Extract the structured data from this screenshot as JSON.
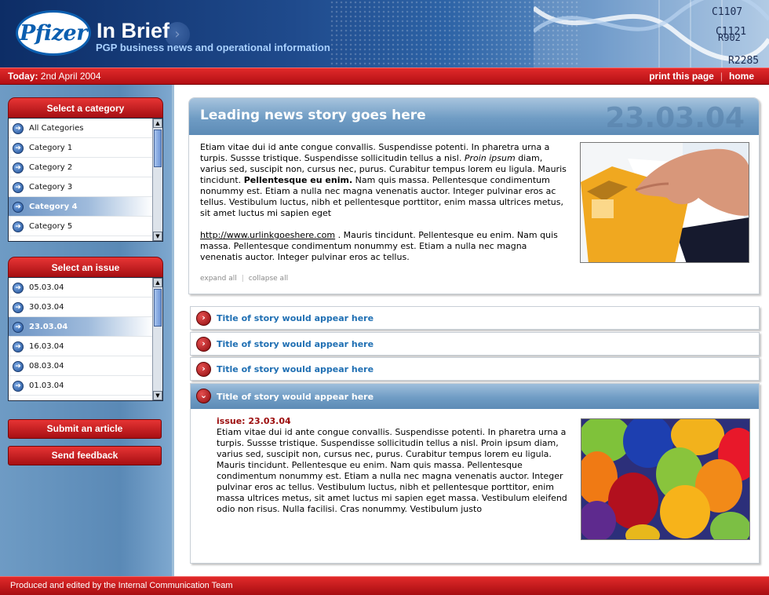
{
  "header": {
    "logo_text": "Pfizer",
    "title": "In Brief",
    "subtitle": "PGP business news and operational information",
    "graphic_codes": [
      "C1107",
      "C1121",
      "R902",
      "R2285"
    ]
  },
  "topbar": {
    "today_label": "Today:",
    "today_value": "2nd April 2004",
    "print_label": "print this page",
    "separator": "|",
    "home_label": "home"
  },
  "sidebar": {
    "category_title": "Select a category",
    "categories": [
      "All Categories",
      "Category 1",
      "Category 2",
      "Category 3",
      "Category 4",
      "Category 5"
    ],
    "active_category": "Category 4",
    "issue_title": "Select an issue",
    "issues": [
      "05.03.04",
      "30.03.04",
      "23.03.04",
      "16.03.04",
      "08.03.04",
      "01.03.04"
    ],
    "active_issue": "23.03.04",
    "submit_label": "Submit an article",
    "feedback_label": "Send feedback"
  },
  "lead": {
    "title": "Leading news story goes here",
    "date": "23.03.04",
    "para1_a": "Etiam vitae dui id ante congue convallis. Suspendisse potenti. In pharetra urna a turpis. Sussse tristique. Suspendisse sollicitudin tellus a nisl. ",
    "para1_italic": "Proin ipsum",
    "para1_b": " diam, varius sed, suscipit non, cursus nec, purus. Curabitur tempus lorem eu ligula. Mauris tincidunt. ",
    "para1_bold": "Pellentesque eu enim.",
    "para1_c": " Nam quis massa. Pellentesque condimentum nonummy est. Etiam a nulla nec magna venenatis auctor. Integer pulvinar eros ac tellus. Vestibulum luctus, nibh et pellentesque porttitor, enim massa ultrices metus, sit amet luctus mi sapien eget",
    "link": "http://www.urlinkgoeshere.com",
    "para2": " . Mauris tincidunt. Pellentesque eu enim. Nam quis massa. Pellentesque condimentum nonummy est. Etiam a nulla nec magna venenatis auctor. Integer pulvinar eros ac tellus.",
    "expand_label": "expand all",
    "controls_sep": "|",
    "collapse_label": "collapse all"
  },
  "stories": [
    {
      "title": "Title of story would appear here"
    },
    {
      "title": "Title of story would appear here"
    },
    {
      "title": "Title of story would appear here"
    }
  ],
  "expanded_story": {
    "title": "Title of story would appear here",
    "issue": "issue: 23.03.04",
    "body": "Etiam vitae dui id ante congue convallis. Suspendisse potenti. In pharetra urna a turpis. Sussse tristique. Suspendisse sollicitudin tellus a nisl. Proin ipsum diam, varius sed, suscipit non, cursus nec, purus. Curabitur tempus lorem eu ligula. Mauris tincidunt. Pellentesque eu enim. Nam quis massa. Pellentesque condimentum nonummy est. Etiam a nulla nec magna venenatis auctor. Integer pulvinar eros ac tellus. Vestibulum luctus, nibh et pellentesque porttitor, enim massa ultrices metus, sit amet luctus mi sapien eget massa. Vestibulum eleifend odio non risus. Nulla facilisi. Cras nonummy. Vestibulum justo"
  },
  "footer": {
    "text": "Produced and edited by the Internal Communication Team"
  },
  "icons": {
    "row": "arrow-right-circle-icon",
    "story_collapsed": "chevron-right-icon",
    "story_expanded": "chevron-down-icon"
  },
  "colors": {
    "brand_red": "#c4161c",
    "brand_blue": "#1f4a8c",
    "link_blue": "#1f6fb3",
    "issue_red": "#9c0c0c"
  }
}
